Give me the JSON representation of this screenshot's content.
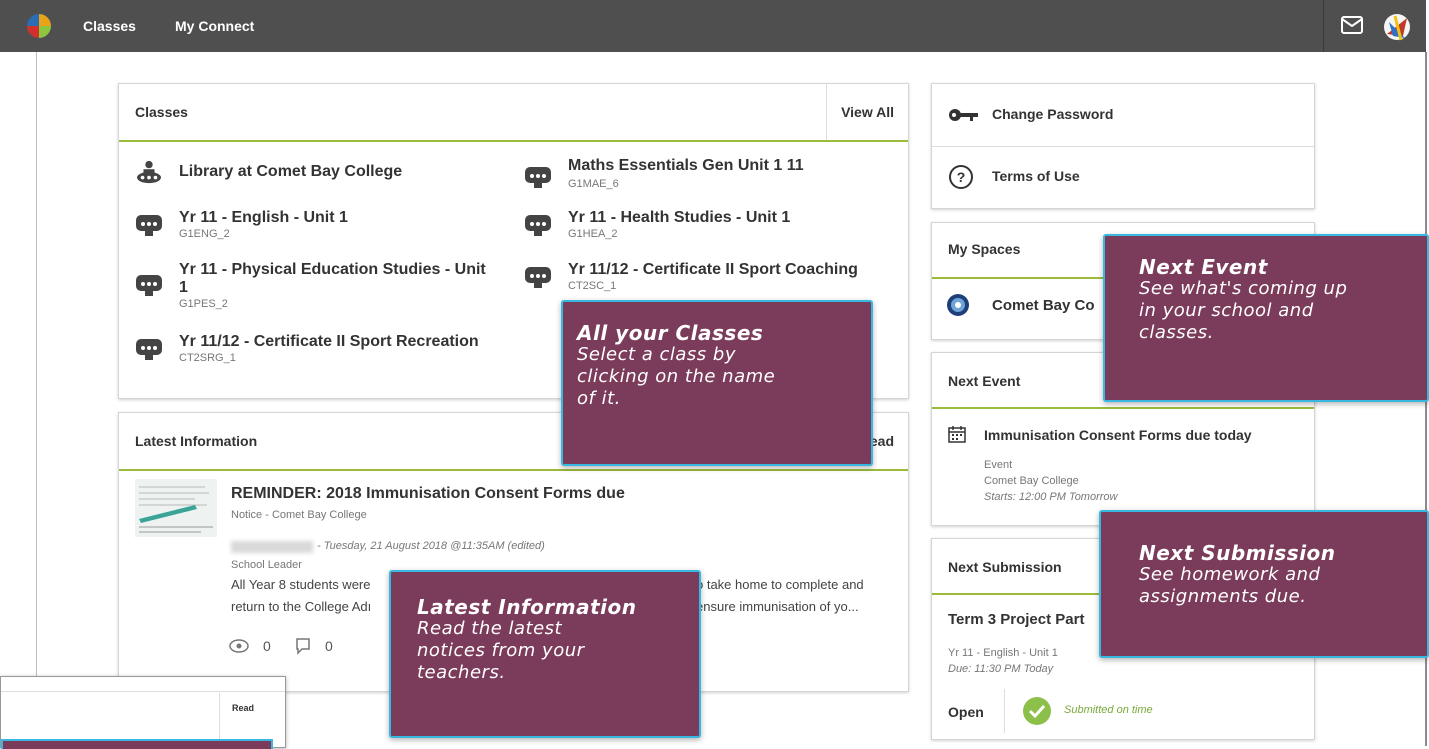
{
  "nav": {
    "items": [
      "Classes",
      "My Connect"
    ]
  },
  "classes_card": {
    "title": "Classes",
    "view_all": "View All",
    "items": [
      {
        "name": "Library at Comet Bay College",
        "code": ""
      },
      {
        "name": "Maths Essentials Gen Unit 1 11",
        "code": "G1MAE_6"
      },
      {
        "name": "Yr 11 - English - Unit 1",
        "code": "G1ENG_2"
      },
      {
        "name": "Yr 11 - Health Studies - Unit 1",
        "code": "G1HEA_2"
      },
      {
        "name": "Yr 11 - Physical Education Studies - Unit",
        "name2": "1",
        "code": "G1PES_2"
      },
      {
        "name": "Yr 11/12 - Certificate II Sport Coaching",
        "code": "CT2SC_1"
      },
      {
        "name": "Yr 11/12 - Certificate II Sport Recreation",
        "code": "CT2SRG_1"
      }
    ]
  },
  "latest_info": {
    "title": "Latest Information",
    "read_link": "ead",
    "notice_title": "REMINDER: 2018 Immunisation Consent Forms due",
    "notice_meta": "Notice - Comet Bay College",
    "posted": "- Tuesday, 21 August 2018 @11:35AM (edited)",
    "role": "School Leader",
    "body_line1": "All Year 8 students were",
    "body_line1_right": "o take home to complete and",
    "body_line2": "return to the College Adı",
    "body_line2_right": "ensure immunisation of yo...",
    "views": "0",
    "comments": "0"
  },
  "sidebar": {
    "change_password": "Change Password",
    "terms": "Terms of Use",
    "my_spaces_title": "My Spaces",
    "space_name": "Comet Bay Co",
    "next_event_title": "Next Event",
    "event_name": "Immunisation Consent Forms due today",
    "event_type": "Event",
    "event_location": "Comet Bay College",
    "event_start": "Starts: 12:00 PM Tomorrow",
    "next_submission_title": "Next Submission",
    "submission_name": "Term 3 Project Part",
    "submission_class": "Yr 11 - English - Unit 1",
    "submission_due": "Due: 11:30 PM Today",
    "submission_status": "Open",
    "submission_result": "Submitted on time"
  },
  "callouts": {
    "classes": {
      "title": "All your Classes",
      "l1": "Select a class by",
      "l2": "clicking on the name",
      "l3": "of it."
    },
    "event": {
      "title": "Next Event",
      "l1": "See what's coming up",
      "l2": "in your school and",
      "l3": "classes."
    },
    "info": {
      "title": "Latest Information",
      "l1": "Read the latest",
      "l2": "notices from your",
      "l3": "teachers."
    },
    "submission": {
      "title": "Next Submission",
      "l1": "See homework and",
      "l2": "assignments due."
    }
  },
  "mini_preview": {
    "read": "Read"
  },
  "colors": {
    "topbar": "#4f4f4f",
    "accent_green": "#9bbb3b",
    "callout_bg": "#7b3b5a",
    "callout_border": "#38b8e0"
  }
}
